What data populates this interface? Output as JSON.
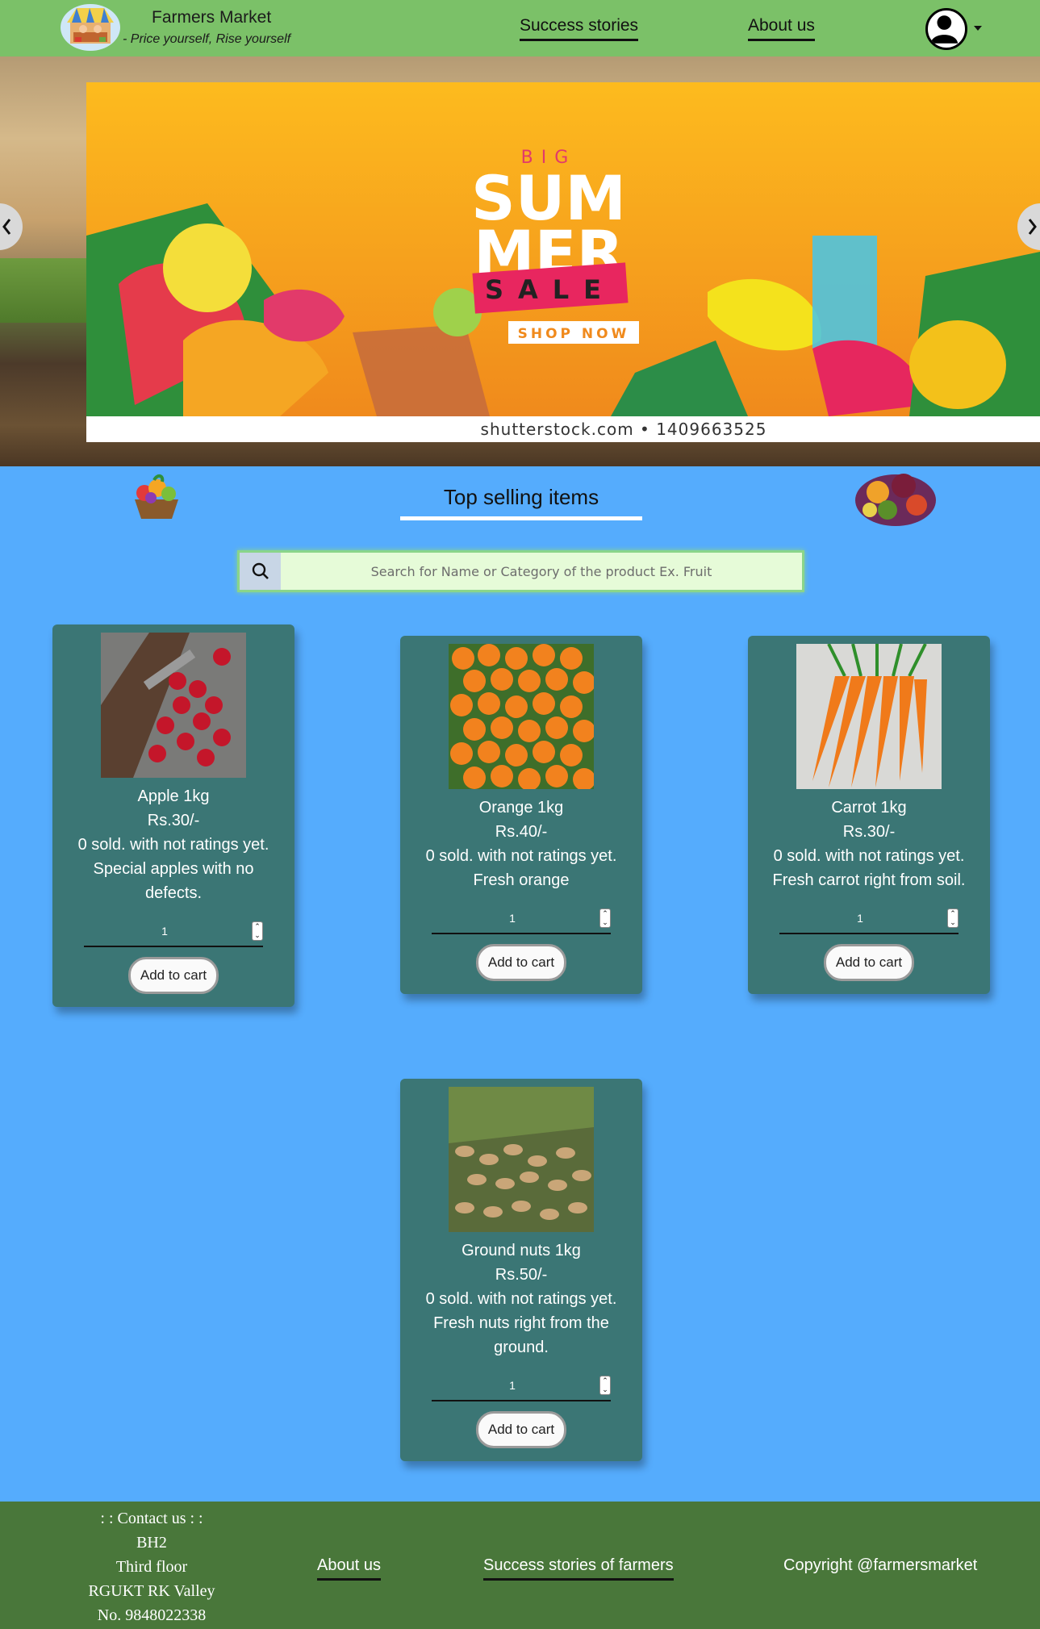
{
  "navbar": {
    "brand_title": "Farmers Market",
    "brand_tagline": "- Price yourself, Rise yourself",
    "links": [
      "Success stories",
      "About us"
    ],
    "bg_color": "#7bc168",
    "logo_icon": "market-stall-icon",
    "profile_icon": "user-avatar-icon",
    "menu_icon": "caret-down-icon"
  },
  "hero": {
    "banner_heading_small": "BIG",
    "banner_heading_1": "SUM",
    "banner_heading_2": "MER",
    "banner_ribbon": "SALE",
    "banner_button": "SHOP NOW",
    "banner_credit": "shutterstock.com • 1409663525",
    "prev_icon": "chevron-left-icon",
    "next_icon": "chevron-right-icon"
  },
  "section": {
    "title": "Top selling items",
    "left_icon": "fruit-basket-icon",
    "right_icon": "fruit-pile-icon"
  },
  "search": {
    "placeholder": "Search for Name or Category of the product Ex. Fruit",
    "icon": "search-icon"
  },
  "products": [
    {
      "name": "Apple 1kg",
      "price": "Rs.30/-",
      "meta": "0 sold. with not ratings yet.",
      "desc": "Special apples with no defects.",
      "qty": "1",
      "button": "Add to cart"
    },
    {
      "name": "Orange 1kg",
      "price": "Rs.40/-",
      "meta": "0 sold. with not ratings yet.",
      "desc": "Fresh orange",
      "qty": "1",
      "button": "Add to cart"
    },
    {
      "name": "Carrot 1kg",
      "price": "Rs.30/-",
      "meta": "0 sold. with not ratings yet.",
      "desc": "Fresh carrot right from soil.",
      "qty": "1",
      "button": "Add to cart"
    },
    {
      "name": "Ground nuts 1kg",
      "price": "Rs.50/-",
      "meta": "0 sold. with not ratings yet.",
      "desc": "Fresh nuts right from the ground.",
      "qty": "1",
      "button": "Add to cart"
    }
  ],
  "footer": {
    "contact": [
      ": : Contact us : :",
      "BH2",
      "Third floor",
      "RGUKT RK Valley",
      "No. 9848022338"
    ],
    "about_link": "About us",
    "stories_link": "Success stories of farmers",
    "copyright": "Copyright @farmersmarket",
    "bg_color": "#49773a"
  },
  "colors": {
    "page_bg": "#55acfd",
    "card_bg": "#3b7675",
    "search_bg": "#e6fbd8"
  }
}
